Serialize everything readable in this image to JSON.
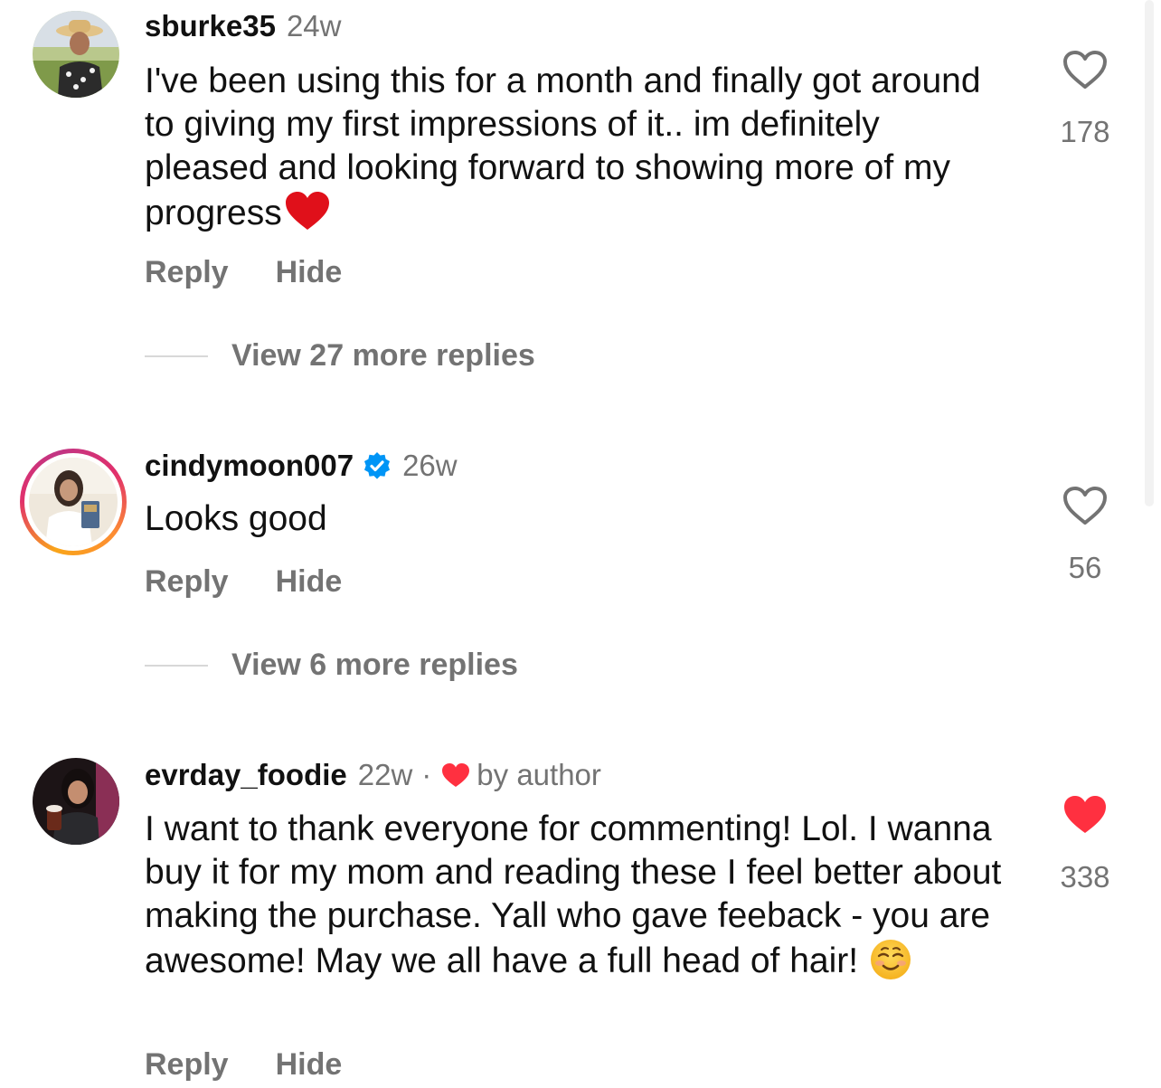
{
  "labels": {
    "reply": "Reply",
    "hide": "Hide"
  },
  "comments": [
    {
      "username": "sburke35",
      "time": "24w",
      "text": "I've been using this for a month and finally got around to giving my first impressions of it.. im definitely pleased and looking forward to showing more of my progress",
      "text_emoji": "red-heart-emoji",
      "likes": "178",
      "liked": false,
      "view_replies": "View 27 more replies",
      "verified": false,
      "story_ring": false
    },
    {
      "username": "cindymoon007",
      "time": "26w",
      "text": "Looks good",
      "likes": "56",
      "liked": false,
      "view_replies": "View 6 more replies",
      "verified": true,
      "story_ring": true
    },
    {
      "username": "evrday_foodie",
      "time": "22w",
      "separator": "·",
      "author_badge": "by author",
      "text": "I want to thank everyone for commenting! Lol. I wanna buy it for my mom and reading these I feel better about making the purchase. Yall who gave feeback - you are awesome! May we all have a full head of hair!",
      "text_emoji": "smiling-face-emoji",
      "likes": "338",
      "liked": true,
      "verified": false,
      "story_ring": false
    }
  ],
  "colors": {
    "secondary_text": "#737373",
    "primary_text": "#111111",
    "like_red": "#ff3040",
    "verified_blue": "#0095f6"
  }
}
